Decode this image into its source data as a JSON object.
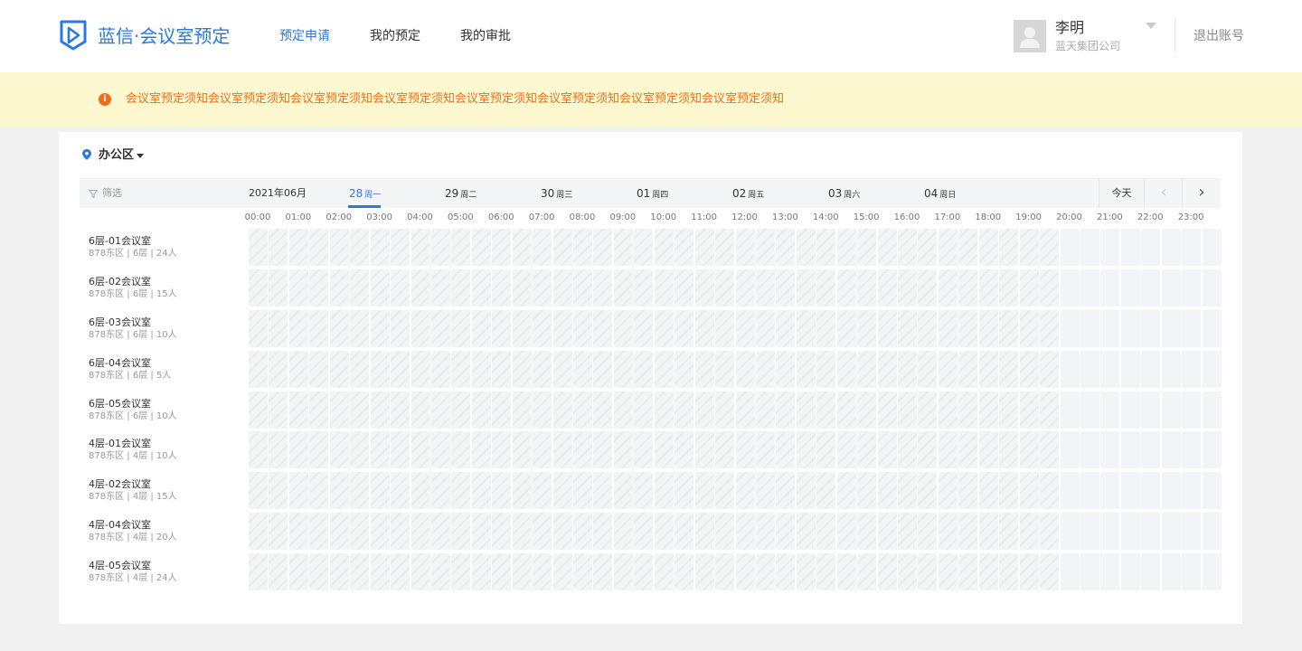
{
  "header": {
    "brand": "蓝信·会议室预定",
    "nav": [
      "预定申请",
      "我的预定",
      "我的审批"
    ],
    "active_nav": 0,
    "user": {
      "name": "李明",
      "org": "蓝天集团公司"
    },
    "logout": "退出账号"
  },
  "notice": {
    "icon": "info-icon",
    "text": "会议室预定须知会议室预定须知会议室预定须知会议室预定须知会议室预定须知会议室预定须知会议室预定须知会议室预定须知"
  },
  "location": {
    "label": "办公区"
  },
  "datebar": {
    "filter_label": "筛选",
    "month": "2021年06月",
    "days": [
      {
        "day": "28",
        "weekday": "周一"
      },
      {
        "day": "29",
        "weekday": "周二"
      },
      {
        "day": "30",
        "weekday": "周三"
      },
      {
        "day": "01",
        "weekday": "周四"
      },
      {
        "day": "02",
        "weekday": "周五"
      },
      {
        "day": "03",
        "weekday": "周六"
      },
      {
        "day": "04",
        "weekday": "周日"
      }
    ],
    "active_day": 0,
    "today": "今天",
    "prev": "‹",
    "next": "›"
  },
  "hours": [
    "00:00",
    "01:00",
    "02:00",
    "03:00",
    "04:00",
    "05:00",
    "06:00",
    "07:00",
    "08:00",
    "09:00",
    "10:00",
    "11:00",
    "12:00",
    "13:00",
    "14:00",
    "15:00",
    "16:00",
    "17:00",
    "18:00",
    "19:00",
    "20:00",
    "21:00",
    "22:00",
    "23:00"
  ],
  "past_until_hour": 20,
  "rooms": [
    {
      "name": "6层-01会议室",
      "meta": "878东区 | 6层 | 24人"
    },
    {
      "name": "6层-02会议室",
      "meta": "878东区 | 6层 | 15人"
    },
    {
      "name": "6层-03会议室",
      "meta": "878东区 | 6层 | 10人"
    },
    {
      "name": "6层-04会议室",
      "meta": "878东区 | 6层 | 5人"
    },
    {
      "name": "6层-05会议室",
      "meta": "878东区 | 6层 | 10人"
    },
    {
      "name": "4层-01会议室",
      "meta": "878东区 | 4层 | 10人"
    },
    {
      "name": "4层-02会议室",
      "meta": "878东区 | 4层 | 15人"
    },
    {
      "name": "4层-04会议室",
      "meta": "878东区 | 4层 | 20人"
    },
    {
      "name": "4层-05会议室",
      "meta": "878东区 | 4层 | 24人"
    }
  ],
  "colors": {
    "accent": "#2a78e0",
    "notice_text": "#f06e1d",
    "notice_bg": "#fdf8d0"
  }
}
